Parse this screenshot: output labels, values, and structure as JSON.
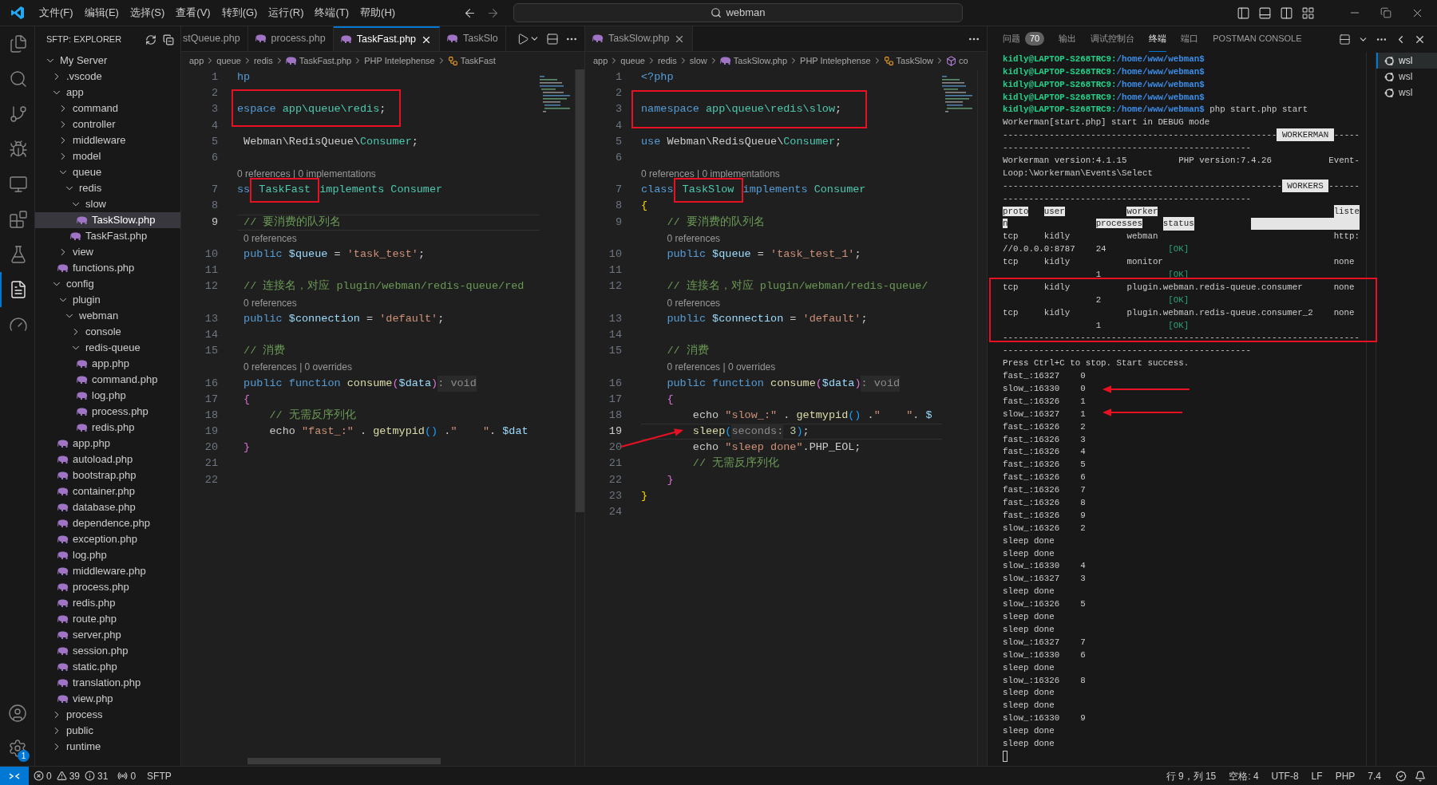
{
  "title_bar": {
    "menu": [
      "文件(F)",
      "编辑(E)",
      "选择(S)",
      "查看(V)",
      "转到(G)",
      "运行(R)",
      "终端(T)",
      "帮助(H)"
    ],
    "search": {
      "value": "webman"
    }
  },
  "activity_bar": {
    "items": [
      {
        "kind": "explorer",
        "selected": false
      },
      {
        "kind": "search",
        "selected": false
      },
      {
        "kind": "scm",
        "selected": false
      },
      {
        "kind": "debug",
        "selected": false
      },
      {
        "kind": "remote",
        "selected": false
      },
      {
        "kind": "extensions",
        "selected": false
      },
      {
        "kind": "testing",
        "selected": false
      },
      {
        "kind": "sftp",
        "selected": true
      },
      {
        "kind": "postman",
        "selected": false
      }
    ],
    "bottom": [
      {
        "kind": "account"
      },
      {
        "kind": "settings",
        "badge": "1"
      }
    ]
  },
  "sidebar": {
    "title": "SFTP: EXPLORER",
    "tree": [
      {
        "label": "My Server",
        "kind": "folder",
        "expanded": true,
        "selected": false,
        "children": [
          {
            "label": ".vscode",
            "kind": "folder",
            "expanded": false,
            "selected": false
          },
          {
            "label": "app",
            "kind": "folder",
            "expanded": true,
            "selected": false,
            "children": [
              {
                "label": "command",
                "kind": "folder",
                "expanded": false,
                "selected": false
              },
              {
                "label": "controller",
                "kind": "folder",
                "expanded": false,
                "selected": false
              },
              {
                "label": "middleware",
                "kind": "folder",
                "expanded": false,
                "selected": false
              },
              {
                "label": "model",
                "kind": "folder",
                "expanded": false,
                "selected": false
              },
              {
                "label": "queue",
                "kind": "folder",
                "expanded": true,
                "selected": false,
                "children": [
                  {
                    "label": "redis",
                    "kind": "folder",
                    "expanded": true,
                    "selected": false,
                    "children": [
                      {
                        "label": "slow",
                        "kind": "folder",
                        "expanded": true,
                        "selected": false,
                        "children": [
                          {
                            "label": "TaskSlow.php",
                            "kind": "file",
                            "selected": true
                          }
                        ]
                      },
                      {
                        "label": "TaskFast.php",
                        "kind": "file",
                        "selected": false
                      }
                    ]
                  }
                ]
              },
              {
                "label": "view",
                "kind": "folder",
                "expanded": false,
                "selected": false
              },
              {
                "label": "functions.php",
                "kind": "file",
                "selected": false
              }
            ]
          },
          {
            "label": "config",
            "kind": "folder",
            "expanded": true,
            "selected": false,
            "children": [
              {
                "label": "plugin",
                "kind": "folder",
                "expanded": true,
                "selected": false,
                "children": [
                  {
                    "label": "webman",
                    "kind": "folder",
                    "expanded": true,
                    "selected": false,
                    "children": [
                      {
                        "label": "console",
                        "kind": "folder",
                        "expanded": false,
                        "selected": false
                      },
                      {
                        "label": "redis-queue",
                        "kind": "folder",
                        "expanded": true,
                        "selected": false,
                        "children": [
                          {
                            "label": "app.php",
                            "kind": "file",
                            "selected": false
                          },
                          {
                            "label": "command.php",
                            "kind": "file",
                            "selected": false
                          },
                          {
                            "label": "log.php",
                            "kind": "file",
                            "selected": false
                          },
                          {
                            "label": "process.php",
                            "kind": "file",
                            "selected": false
                          },
                          {
                            "label": "redis.php",
                            "kind": "file",
                            "selected": false
                          }
                        ]
                      }
                    ]
                  }
                ]
              },
              {
                "label": "app.php",
                "kind": "file",
                "selected": false
              },
              {
                "label": "autoload.php",
                "kind": "file",
                "selected": false
              },
              {
                "label": "bootstrap.php",
                "kind": "file",
                "selected": false
              },
              {
                "label": "container.php",
                "kind": "file",
                "selected": false
              },
              {
                "label": "database.php",
                "kind": "file",
                "selected": false
              },
              {
                "label": "dependence.php",
                "kind": "file",
                "selected": false
              },
              {
                "label": "exception.php",
                "kind": "file",
                "selected": false
              },
              {
                "label": "log.php",
                "kind": "file",
                "selected": false
              },
              {
                "label": "middleware.php",
                "kind": "file",
                "selected": false
              },
              {
                "label": "process.php",
                "kind": "file",
                "selected": false
              },
              {
                "label": "redis.php",
                "kind": "file",
                "selected": false
              },
              {
                "label": "route.php",
                "kind": "file",
                "selected": false
              },
              {
                "label": "server.php",
                "kind": "file",
                "selected": false
              },
              {
                "label": "session.php",
                "kind": "file",
                "selected": false
              },
              {
                "label": "static.php",
                "kind": "file",
                "selected": false
              },
              {
                "label": "translation.php",
                "kind": "file",
                "selected": false
              },
              {
                "label": "view.php",
                "kind": "file",
                "selected": false
              }
            ]
          },
          {
            "label": "process",
            "kind": "folder",
            "expanded": false,
            "selected": false
          },
          {
            "label": "public",
            "kind": "folder",
            "expanded": false,
            "selected": false
          },
          {
            "label": "runtime",
            "kind": "folder",
            "expanded": false,
            "selected": false
          }
        ]
      }
    ]
  },
  "editor_groups": [
    {
      "focused": true,
      "tabs": [
        {
          "label": "stQueue.php",
          "selected": false,
          "cut": true
        },
        {
          "label": "process.php",
          "selected": false,
          "cut": false
        },
        {
          "label": "TaskFast.php",
          "selected": true,
          "cut": false
        },
        {
          "label": "TaskSlo",
          "selected": false,
          "cut": false
        }
      ],
      "actions": [
        {
          "kind": "run"
        },
        {
          "kind": "split"
        },
        {
          "kind": "more"
        }
      ],
      "breadcrumb": [
        {
          "label": "app",
          "kind": "folder"
        },
        {
          "label": "queue",
          "kind": "folder"
        },
        {
          "label": "redis",
          "kind": "folder"
        },
        {
          "label": "TaskFast.php",
          "kind": "php_file"
        },
        {
          "label": "PHP Intelephense",
          "kind": "language"
        },
        {
          "label": "TaskFast",
          "kind": "class"
        }
      ],
      "lines": [
        {
          "kind": "code",
          "number": "1",
          "current": false,
          "tokens": [
            {
              "kind": "keyword",
              "text": "hp"
            }
          ]
        },
        {
          "kind": "code",
          "number": "2",
          "current": false
        },
        {
          "kind": "code",
          "number": "3",
          "current": false,
          "tokens": [
            {
              "kind": "keyword",
              "text": "espace"
            },
            {
              "kind": "type",
              "text": " app\\queue\\redis"
            },
            {
              "kind": "plain",
              "text": ";"
            }
          ]
        },
        {
          "kind": "code",
          "number": "4",
          "current": false
        },
        {
          "kind": "code",
          "number": "5",
          "current": false,
          "tokens": [
            {
              "kind": "plain",
              "text": " Webman\\RedisQueue\\"
            },
            {
              "kind": "type",
              "text": "Consumer"
            },
            {
              "kind": "plain",
              "text": ";"
            }
          ]
        },
        {
          "kind": "code",
          "number": "6",
          "current": false
        },
        {
          "kind": "lens",
          "text": "0 references | 0 implementations"
        },
        {
          "kind": "code",
          "number": "7",
          "current": false,
          "tokens": [
            {
              "kind": "keyword",
              "text": "ss"
            },
            {
              "kind": "type",
              "text": " TaskFast ",
              "annotated": true
            },
            {
              "kind": "type",
              "text": "implements"
            },
            {
              "kind": "type",
              "text": " Consumer"
            }
          ]
        },
        {
          "kind": "code",
          "number": "8",
          "current": false
        },
        {
          "kind": "code",
          "number": "9",
          "current": true,
          "tokens": [
            {
              "kind": "comment",
              "text": " // 要消费的队列名"
            }
          ]
        },
        {
          "kind": "lens",
          "text": "0 references"
        },
        {
          "kind": "code",
          "number": "10",
          "current": false,
          "tokens": [
            {
              "kind": "keyword",
              "text": " public"
            },
            {
              "kind": "variable",
              "text": " $queue"
            },
            {
              "kind": "plain",
              "text": " = "
            },
            {
              "kind": "string",
              "text": "'task_test'"
            },
            {
              "kind": "plain",
              "text": ";"
            }
          ]
        },
        {
          "kind": "code",
          "number": "11",
          "current": false
        },
        {
          "kind": "code",
          "number": "12",
          "current": false,
          "tokens": [
            {
              "kind": "comment",
              "text": " // 连接名，对应 plugin/webman/redis-queue/red"
            }
          ]
        },
        {
          "kind": "lens",
          "text": "0 references"
        },
        {
          "kind": "code",
          "number": "13",
          "current": false,
          "tokens": [
            {
              "kind": "keyword",
              "text": " public"
            },
            {
              "kind": "variable",
              "text": " $connection"
            },
            {
              "kind": "plain",
              "text": " = "
            },
            {
              "kind": "string",
              "text": "'default'"
            },
            {
              "kind": "plain",
              "text": ";"
            }
          ]
        },
        {
          "kind": "code",
          "number": "14",
          "current": false
        },
        {
          "kind": "code",
          "number": "15",
          "current": false,
          "tokens": [
            {
              "kind": "comment",
              "text": " // 消费"
            }
          ]
        },
        {
          "kind": "lens",
          "text": "0 references | 0 overrides"
        },
        {
          "kind": "code",
          "number": "16",
          "current": false,
          "tokens": [
            {
              "kind": "keyword",
              "text": " public"
            },
            {
              "kind": "keyword",
              "text": " function"
            },
            {
              "kind": "function",
              "text": " consume"
            },
            {
              "kind": "brace2",
              "text": "("
            },
            {
              "kind": "variable",
              "text": "$data"
            },
            {
              "kind": "brace2",
              "text": ")"
            },
            {
              "kind": "hint",
              "text": ": void"
            }
          ]
        },
        {
          "kind": "code",
          "number": "17",
          "current": false,
          "tokens": [
            {
              "kind": "brace2",
              "text": " {"
            }
          ]
        },
        {
          "kind": "code",
          "number": "18",
          "current": false,
          "tokens": [
            {
              "kind": "comment",
              "text": "     // 无需反序列化"
            }
          ]
        },
        {
          "kind": "code",
          "number": "19",
          "current": false,
          "tokens": [
            {
              "kind": "plain",
              "text": "     echo"
            },
            {
              "kind": "string",
              "text": " \"fast_:\""
            },
            {
              "kind": "plain",
              "text": " . "
            },
            {
              "kind": "function",
              "text": "getmypid"
            },
            {
              "kind": "brace3",
              "text": "()"
            },
            {
              "kind": "plain",
              "text": " ."
            },
            {
              "kind": "string",
              "text": "\"    \""
            },
            {
              "kind": "plain",
              "text": ". "
            },
            {
              "kind": "variable",
              "text": "$dat"
            }
          ]
        },
        {
          "kind": "code",
          "number": "20",
          "current": false,
          "tokens": [
            {
              "kind": "brace2",
              "text": " }"
            }
          ]
        },
        {
          "kind": "code",
          "number": "21",
          "current": false
        },
        {
          "kind": "code",
          "number": "22",
          "current": false
        }
      ]
    },
    {
      "focused": false,
      "tabs": [
        {
          "label": "TaskSlow.php",
          "selected": true,
          "cut": false
        }
      ],
      "actions": [
        {
          "kind": "more"
        }
      ],
      "breadcrumb": [
        {
          "label": "app",
          "kind": "folder"
        },
        {
          "label": "queue",
          "kind": "folder"
        },
        {
          "label": "redis",
          "kind": "folder"
        },
        {
          "label": "slow",
          "kind": "folder"
        },
        {
          "label": "TaskSlow.php",
          "kind": "php_file"
        },
        {
          "label": "PHP Intelephense",
          "kind": "language"
        },
        {
          "label": "TaskSlow",
          "kind": "class"
        },
        {
          "label": "co",
          "kind": "method"
        }
      ],
      "lines": [
        {
          "kind": "code",
          "number": "1",
          "current": false,
          "tokens": [
            {
              "kind": "keyword",
              "text": "<?php"
            }
          ]
        },
        {
          "kind": "code",
          "number": "2",
          "current": false
        },
        {
          "kind": "code",
          "number": "3",
          "current": false,
          "tokens": [
            {
              "kind": "keyword",
              "text": "namespace"
            },
            {
              "kind": "type",
              "text": " app\\queue\\redis\\slow"
            },
            {
              "kind": "plain",
              "text": ";"
            }
          ]
        },
        {
          "kind": "code",
          "number": "4",
          "current": false
        },
        {
          "kind": "code",
          "number": "5",
          "current": false,
          "tokens": [
            {
              "kind": "keyword",
              "text": "use"
            },
            {
              "kind": "plain",
              "text": " Webman\\RedisQueue\\"
            },
            {
              "kind": "type",
              "text": "Consumer"
            },
            {
              "kind": "plain",
              "text": ";"
            }
          ]
        },
        {
          "kind": "code",
          "number": "6",
          "current": false
        },
        {
          "kind": "lens",
          "text": "0 references | 0 implementations"
        },
        {
          "kind": "code",
          "number": "7",
          "current": false,
          "tokens": [
            {
              "kind": "keyword",
              "text": "class"
            },
            {
              "kind": "type",
              "text": " TaskSlow ",
              "annotated": true
            },
            {
              "kind": "keyword",
              "text": "implements"
            },
            {
              "kind": "type",
              "text": " Consumer"
            }
          ]
        },
        {
          "kind": "code",
          "number": "8",
          "current": false,
          "tokens": [
            {
              "kind": "brace1",
              "text": "{"
            }
          ]
        },
        {
          "kind": "code",
          "number": "9",
          "current": false,
          "tokens": [
            {
              "kind": "comment",
              "text": "    // 要消费的队列名"
            }
          ]
        },
        {
          "kind": "lens",
          "text": "0 references"
        },
        {
          "kind": "code",
          "number": "10",
          "current": false,
          "tokens": [
            {
              "kind": "keyword",
              "text": "    public"
            },
            {
              "kind": "variable",
              "text": " $queue"
            },
            {
              "kind": "plain",
              "text": " = "
            },
            {
              "kind": "string",
              "text": "'task_test_1'"
            },
            {
              "kind": "plain",
              "text": ";"
            }
          ]
        },
        {
          "kind": "code",
          "number": "11",
          "current": false
        },
        {
          "kind": "code",
          "number": "12",
          "current": false,
          "tokens": [
            {
              "kind": "comment",
              "text": "    // 连接名，对应 plugin/webman/redis-queue/"
            }
          ]
        },
        {
          "kind": "lens",
          "text": "0 references"
        },
        {
          "kind": "code",
          "number": "13",
          "current": false,
          "tokens": [
            {
              "kind": "keyword",
              "text": "    public"
            },
            {
              "kind": "variable",
              "text": " $connection"
            },
            {
              "kind": "plain",
              "text": " = "
            },
            {
              "kind": "string",
              "text": "'default'"
            },
            {
              "kind": "plain",
              "text": ";"
            }
          ]
        },
        {
          "kind": "code",
          "number": "14",
          "current": false
        },
        {
          "kind": "code",
          "number": "15",
          "current": false,
          "tokens": [
            {
              "kind": "comment",
              "text": "    // 消费"
            }
          ]
        },
        {
          "kind": "lens",
          "text": "0 references | 0 overrides"
        },
        {
          "kind": "code",
          "number": "16",
          "current": false,
          "tokens": [
            {
              "kind": "keyword",
              "text": "    public"
            },
            {
              "kind": "keyword",
              "text": " function"
            },
            {
              "kind": "function",
              "text": " consume"
            },
            {
              "kind": "brace2",
              "text": "("
            },
            {
              "kind": "variable",
              "text": "$data"
            },
            {
              "kind": "brace2",
              "text": ")"
            },
            {
              "kind": "hint",
              "text": ": void"
            }
          ]
        },
        {
          "kind": "code",
          "number": "17",
          "current": false,
          "tokens": [
            {
              "kind": "brace2",
              "text": "    {"
            }
          ]
        },
        {
          "kind": "code",
          "number": "18",
          "current": false,
          "tokens": [
            {
              "kind": "plain",
              "text": "        echo"
            },
            {
              "kind": "string",
              "text": " \"slow_:\""
            },
            {
              "kind": "plain",
              "text": " . "
            },
            {
              "kind": "function",
              "text": "getmypid"
            },
            {
              "kind": "brace3",
              "text": "()"
            },
            {
              "kind": "plain",
              "text": " ."
            },
            {
              "kind": "string",
              "text": "\"    \""
            },
            {
              "kind": "plain",
              "text": ". "
            },
            {
              "kind": "variable",
              "text": "$"
            }
          ]
        },
        {
          "kind": "code",
          "number": "19",
          "current": true,
          "tokens": [
            {
              "kind": "function",
              "text": "        sleep"
            },
            {
              "kind": "brace3",
              "text": "("
            },
            {
              "kind": "hint",
              "text": "seconds:"
            },
            {
              "kind": "number",
              "text": " 3"
            },
            {
              "kind": "brace3",
              "text": ")"
            },
            {
              "kind": "plain",
              "text": ";"
            }
          ]
        },
        {
          "kind": "code",
          "number": "20",
          "current": false,
          "tokens": [
            {
              "kind": "plain",
              "text": "        echo"
            },
            {
              "kind": "string",
              "text": " \"sleep done\""
            },
            {
              "kind": "plain",
              "text": ".PHP_EOL;"
            }
          ]
        },
        {
          "kind": "code",
          "number": "21",
          "current": false,
          "tokens": [
            {
              "kind": "comment",
              "text": "        // 无需反序列化"
            }
          ]
        },
        {
          "kind": "code",
          "number": "22",
          "current": false,
          "tokens": [
            {
              "kind": "brace2",
              "text": "    }"
            }
          ]
        },
        {
          "kind": "code",
          "number": "23",
          "current": false,
          "tokens": [
            {
              "kind": "brace1",
              "text": "}"
            }
          ]
        },
        {
          "kind": "code",
          "number": "24",
          "current": false
        }
      ]
    }
  ],
  "panel": {
    "tabs": [
      {
        "label": "问题",
        "badge": "70",
        "selected": false
      },
      {
        "label": "输出",
        "selected": false
      },
      {
        "label": "调试控制台",
        "selected": false
      },
      {
        "label": "终端",
        "selected": true
      },
      {
        "label": "端口",
        "selected": false
      },
      {
        "label": "POSTMAN CONSOLE",
        "selected": false
      }
    ],
    "sessions": [
      {
        "label": "wsl",
        "selected": true
      },
      {
        "label": "wsl",
        "selected": false
      },
      {
        "label": "wsl",
        "selected": false
      }
    ],
    "terminal": {
      "lines": [
        {
          "kind": "prompt",
          "user": "kidly@LAPTOP-S268TRC9:",
          "path": "/home/www/webman$"
        },
        {
          "kind": "prompt",
          "user": "kidly@LAPTOP-S268TRC9:",
          "path": "/home/www/webman$"
        },
        {
          "kind": "prompt",
          "user": "kidly@LAPTOP-S268TRC9:",
          "path": "/home/www/webman$"
        },
        {
          "kind": "prompt",
          "user": "kidly@LAPTOP-S268TRC9:",
          "path": "/home/www/webman$"
        },
        {
          "kind": "prompt",
          "user": "kidly@LAPTOP-S268TRC9:",
          "path": "/home/www/webman$",
          "command": "php start.php start"
        },
        {
          "kind": "text",
          "text": "Workerman[start.php] start in DEBUG mode"
        },
        {
          "kind": "banner",
          "left": "-----------------------------------------------------",
          "label": "WORKERMAN",
          "right": "-----"
        },
        {
          "kind": "text",
          "text": "------------------------------------------------"
        },
        {
          "kind": "text",
          "text": "Workerman version:4.1.15          PHP version:7.4.26           Event-"
        },
        {
          "kind": "text",
          "text": "Loop:\\Workerman\\Events\\Select"
        },
        {
          "kind": "banner",
          "left": "------------------------------------------------------",
          "label": "WORKERS",
          "right": "------"
        },
        {
          "kind": "text",
          "text": "------------------------------------------------"
        },
        {
          "kind": "header",
          "proto": "proto",
          "user": "user",
          "worker": "worker",
          "listen": "liste",
          "wrap": "n",
          "processes": "processes",
          "status": "status"
        },
        {
          "kind": "row",
          "proto": "tcp",
          "user": "kidly",
          "worker": "webman",
          "listen": "http:",
          "wrap": "//0.0.0.0:8787",
          "processes": "24",
          "status": "[OK]"
        },
        {
          "kind": "row",
          "proto": "tcp",
          "user": "kidly",
          "worker": "monitor",
          "listen": "none",
          "processes": "1",
          "status": "[OK]"
        },
        {
          "kind": "row",
          "proto": "tcp",
          "user": "kidly",
          "worker": "plugin.webman.redis-queue.consumer",
          "listen": "none",
          "processes": "2",
          "status": "[OK]"
        },
        {
          "kind": "row",
          "proto": "tcp",
          "user": "kidly",
          "worker": "plugin.webman.redis-queue.consumer_2",
          "listen": "none",
          "processes": "1",
          "status": "[OK]"
        },
        {
          "kind": "text",
          "text": "---------------------------------------------------------------------"
        },
        {
          "kind": "text",
          "text": "------------------------------------------------"
        },
        {
          "kind": "text",
          "text": "Press Ctrl+C to stop. Start success."
        },
        {
          "kind": "text",
          "text": "fast_:16327    0"
        },
        {
          "kind": "text",
          "text": "slow_:16330    0"
        },
        {
          "kind": "text",
          "text": "fast_:16326    1"
        },
        {
          "kind": "text",
          "text": "slow_:16327    1"
        },
        {
          "kind": "text",
          "text": "fast_:16326    2"
        },
        {
          "kind": "text",
          "text": "fast_:16326    3"
        },
        {
          "kind": "text",
          "text": "fast_:16326    4"
        },
        {
          "kind": "text",
          "text": "fast_:16326    5"
        },
        {
          "kind": "text",
          "text": "fast_:16326    6"
        },
        {
          "kind": "text",
          "text": "fast_:16326    7"
        },
        {
          "kind": "text",
          "text": "fast_:16326    8"
        },
        {
          "kind": "text",
          "text": "fast_:16326    9"
        },
        {
          "kind": "text",
          "text": "slow_:16326    2"
        },
        {
          "kind": "text",
          "text": "sleep done"
        },
        {
          "kind": "text",
          "text": "sleep done"
        },
        {
          "kind": "text",
          "text": "slow_:16330    4"
        },
        {
          "kind": "text",
          "text": "slow_:16327    3"
        },
        {
          "kind": "text",
          "text": "sleep done"
        },
        {
          "kind": "text",
          "text": "slow_:16326    5"
        },
        {
          "kind": "text",
          "text": "sleep done"
        },
        {
          "kind": "text",
          "text": "sleep done"
        },
        {
          "kind": "text",
          "text": "slow_:16327    7"
        },
        {
          "kind": "text",
          "text": "slow_:16330    6"
        },
        {
          "kind": "text",
          "text": "sleep done"
        },
        {
          "kind": "text",
          "text": "slow_:16326    8"
        },
        {
          "kind": "text",
          "text": "sleep done"
        },
        {
          "kind": "text",
          "text": "sleep done"
        },
        {
          "kind": "text",
          "text": "slow_:16330    9"
        },
        {
          "kind": "text",
          "text": "sleep done"
        },
        {
          "kind": "text",
          "text": "sleep done"
        },
        {
          "kind": "cursor"
        }
      ]
    }
  },
  "status_bar": {
    "errors": "0",
    "warnings": "39",
    "infos": "31",
    "ports": "0",
    "left_items": [
      "SFTP"
    ],
    "right_items": [
      "行 9，列 15",
      "空格: 4",
      "UTF-8",
      "LF",
      "PHP",
      "7.4"
    ]
  }
}
